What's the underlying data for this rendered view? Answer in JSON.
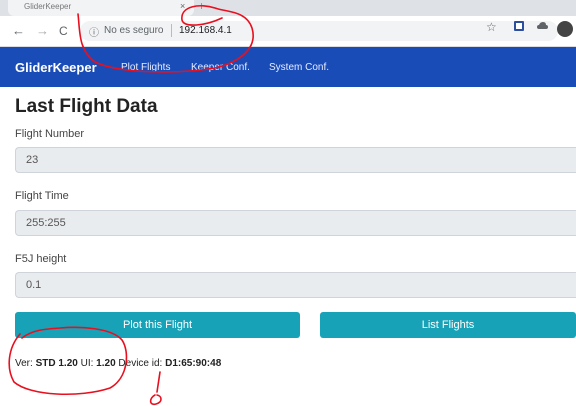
{
  "browser": {
    "tab_title": "GliderKeeper",
    "tab_close": "×",
    "new_tab": "+",
    "back": "←",
    "forward": "→",
    "reload": "C",
    "info": "ⓘ",
    "security": "No es seguro",
    "url": "192.168.4.1",
    "star": "☆"
  },
  "navbar": {
    "brand": "GliderKeeper",
    "links": [
      "Plot Flights",
      "Keeper Conf.",
      "System Conf."
    ]
  },
  "page": {
    "title": "Last Flight Data",
    "fields": [
      {
        "label": "Flight Number",
        "value": "23"
      },
      {
        "label": "Flight Time",
        "value": "255:255"
      },
      {
        "label": "F5J height",
        "value": "0.1"
      }
    ],
    "buttons": {
      "plot": "Plot this Flight",
      "list": "List Flights"
    },
    "footer": {
      "ver_label": "Ver:",
      "ver_value": "STD 1.20",
      "ui_label": "UI:",
      "ui_value": "1.20",
      "device_label": "Device id:",
      "device_value": "D1:65:90:48"
    }
  },
  "colors": {
    "navbar": "#1a4cb8",
    "button": "#17a2b8",
    "annotation": "#e8101e"
  }
}
